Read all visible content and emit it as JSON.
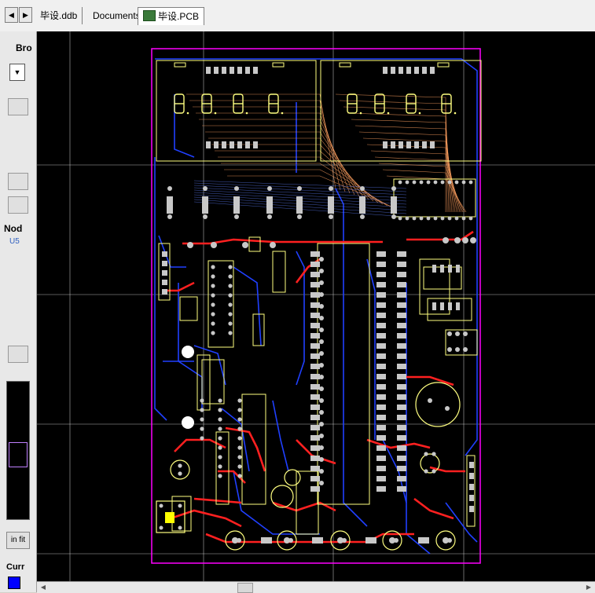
{
  "toolbar": {
    "back_symbol": "◀",
    "forward_symbol": "▶"
  },
  "tabs": [
    {
      "label": "毕设.ddb"
    },
    {
      "label": "Documents"
    },
    {
      "label": "毕设.PCB"
    }
  ],
  "side_panel": {
    "browse_label": "Bro",
    "combo_symbol": "▼",
    "nodes_label": "Nod",
    "node_value": "U5",
    "fit_button": "in fit",
    "current_label": "Curr",
    "current_layer_color": "#0000ff"
  },
  "colors": {
    "background": "#000000",
    "board_outline": "#ff00ff",
    "silkscreen": "#ffff80",
    "top_trace": "#ff2020",
    "bottom_trace": "#2040ff",
    "ratsnest": "#ffa060",
    "grid": "#ffffff",
    "pad": "#c8c8c8"
  },
  "icons": {
    "pcb_doc": "pcb-document-icon",
    "node_icon": "net-node-icon"
  }
}
